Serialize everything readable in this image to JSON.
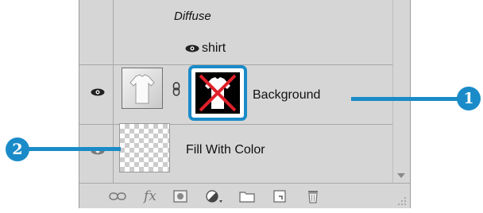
{
  "layers_panel": {
    "effect_label": "Diffuse",
    "shirt_layer_label": "shirt",
    "background_layer_label": "Background",
    "fill_layer_label": "Fill With Color"
  },
  "footer": {
    "icons": [
      "link-layers-icon",
      "fx-icon",
      "add-mask-icon",
      "adjustment-layer-icon",
      "new-group-icon",
      "new-layer-icon",
      "trash-icon"
    ],
    "fx_label": "fx"
  },
  "callouts": {
    "one": "1",
    "two": "2"
  },
  "colors": {
    "accent": "#1a8bc8",
    "panel_bg": "#d6d6d6"
  }
}
